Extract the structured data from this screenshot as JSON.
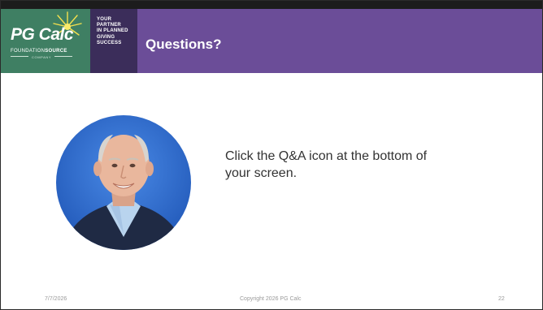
{
  "logo": {
    "brand": "PG Calc",
    "sub_left": "FOUNDATION",
    "sub_right": "SOURCE",
    "sub_company": "COMPANY",
    "tagline": [
      "YOUR",
      "PARTNER",
      "IN PLANNED",
      "GIVING",
      "SUCCESS"
    ]
  },
  "slide": {
    "title": "Questions?",
    "body": "Click the Q&A icon at the bottom of your screen."
  },
  "footer": {
    "date": "7/7/2026",
    "copyright": "Copyright 2026 PG Calc",
    "page": "22"
  },
  "colors": {
    "header_purple": "#6b4d98",
    "logo_green": "#3f7f63",
    "tagline_dark": "#3b2d5a",
    "avatar_bg": "#2f6fd1"
  }
}
